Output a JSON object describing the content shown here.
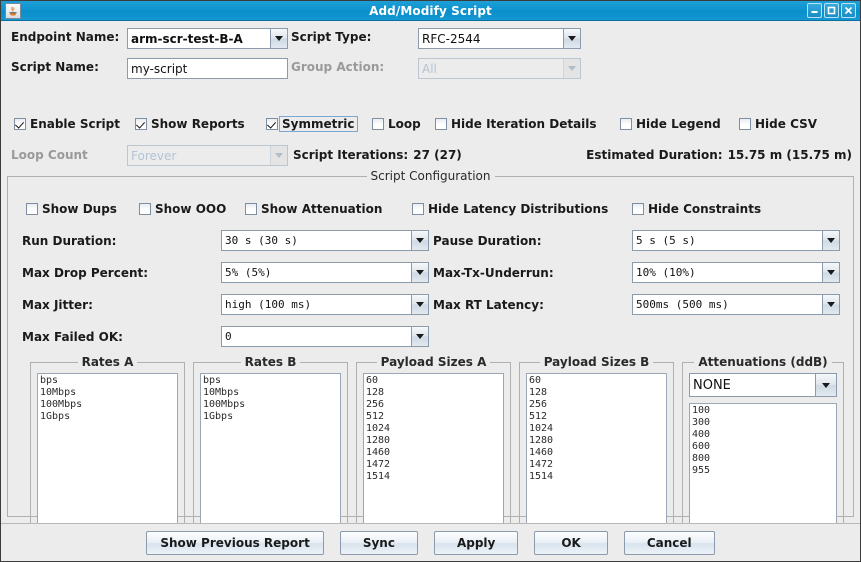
{
  "window": {
    "title": "Add/Modify Script",
    "icon": "java-coffee-cup-icon",
    "buttons": {
      "minimize": "minimize-icon",
      "maximize": "maximize-icon",
      "close": "close-icon"
    }
  },
  "form": {
    "endpoint_name_label": "Endpoint Name:",
    "endpoint_name_value": "arm-scr-test-B-A",
    "script_type_label": "Script Type:",
    "script_type_value": "RFC-2544",
    "script_name_label": "Script Name:",
    "script_name_value": "my-script",
    "group_action_label": "Group Action:",
    "group_action_value": "All"
  },
  "toggles": [
    {
      "label": "Enable Script",
      "checked": true,
      "focused": false
    },
    {
      "label": "Show Reports",
      "checked": true,
      "focused": false
    },
    {
      "label": "Symmetric",
      "checked": true,
      "focused": true
    },
    {
      "label": "Loop",
      "checked": false,
      "focused": false
    },
    {
      "label": "Hide Iteration Details",
      "checked": false,
      "focused": false
    },
    {
      "label": "Hide Legend",
      "checked": false,
      "focused": false
    },
    {
      "label": "Hide CSV",
      "checked": false,
      "focused": false
    }
  ],
  "loop_row": {
    "loop_count_label": "Loop Count",
    "loop_count_value": "Forever",
    "script_iterations_label": "Script Iterations:",
    "script_iterations_value": "27 (27)",
    "estimated_duration_label": "Estimated Duration:",
    "estimated_duration_value": "15.75 m (15.75 m)"
  },
  "script_config": {
    "title": "Script Configuration",
    "toggles": [
      {
        "label": "Show Dups",
        "checked": false
      },
      {
        "label": "Show OOO",
        "checked": false
      },
      {
        "label": "Show Attenuation",
        "checked": false
      },
      {
        "label": "Hide Latency Distributions",
        "checked": false
      },
      {
        "label": "Hide Constraints",
        "checked": false
      }
    ],
    "fields": [
      {
        "label": "Run Duration:",
        "value": "30 s    (30 s)"
      },
      {
        "label": "Pause Duration:",
        "value": "5 s    (5 s)"
      },
      {
        "label": "Max Drop Percent:",
        "value": "5% (5%)"
      },
      {
        "label": "Max-Tx-Underrun:",
        "value": "10% (10%)"
      },
      {
        "label": "Max Jitter:",
        "value": "high (100 ms)"
      },
      {
        "label": "Max RT Latency:",
        "value": "500ms (500 ms)"
      },
      {
        "label": "Max Failed OK:",
        "value": "0"
      }
    ],
    "lists": [
      {
        "title": "Rates A",
        "items": [
          "bps",
          "10Mbps",
          "100Mbps",
          "1Gbps"
        ]
      },
      {
        "title": "Rates B",
        "items": [
          "bps",
          "10Mbps",
          "100Mbps",
          "1Gbps"
        ]
      },
      {
        "title": "Payload Sizes A",
        "items": [
          "60",
          "128",
          "256",
          "512",
          "1024",
          "1280",
          "1460",
          "1472",
          "1514"
        ]
      },
      {
        "title": "Payload Sizes B",
        "items": [
          "60",
          "128",
          "256",
          "512",
          "1024",
          "1280",
          "1460",
          "1472",
          "1514"
        ]
      }
    ],
    "attenuations": {
      "title": "Attenuations (ddB)",
      "selected": "NONE",
      "items": [
        "100",
        "300",
        "400",
        "600",
        "800",
        "955"
      ]
    }
  },
  "footer": {
    "buttons": [
      {
        "label": "Show Previous Report"
      },
      {
        "label": "Sync"
      },
      {
        "label": "Apply"
      },
      {
        "label": "OK"
      },
      {
        "label": "Cancel"
      }
    ]
  },
  "colors": {
    "titlebar": "#0c93cf",
    "background": "#ececec",
    "field_border": "#8c9bab",
    "disabled_text": "#9a9a9a"
  }
}
